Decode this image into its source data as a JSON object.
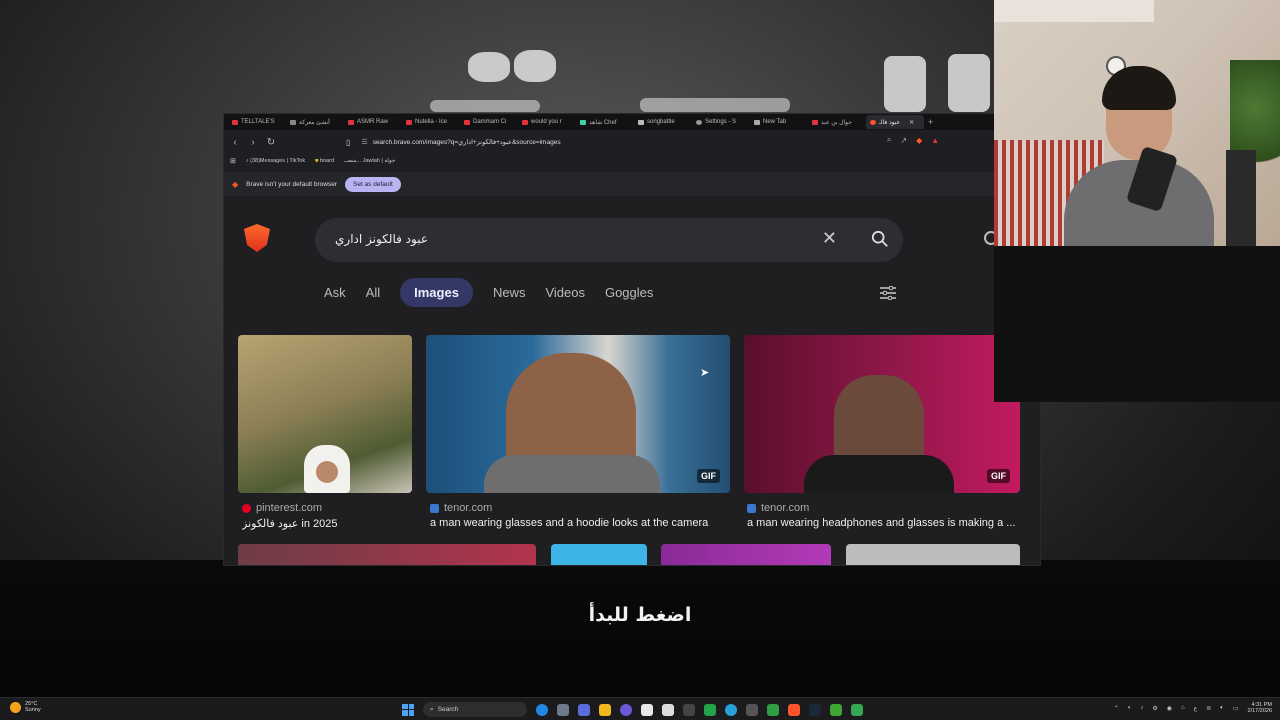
{
  "overlay": {
    "subtitle": "اضغط للبدأ"
  },
  "tabs": [
    {
      "label": "TELLTALE'S"
    },
    {
      "label": "أنشئ معركة"
    },
    {
      "label": "ASMR Raw"
    },
    {
      "label": "Nutella - Ice"
    },
    {
      "label": "Dammam Ci"
    },
    {
      "label": "would you r"
    },
    {
      "label": "شاهد Chef"
    },
    {
      "label": "songbattle"
    },
    {
      "label": "Settings - S"
    },
    {
      "label": "New Tab"
    },
    {
      "label": "جوال بن عبد"
    },
    {
      "label": "عبود فالـ"
    }
  ],
  "address": {
    "url": "search.brave.com/images?q=عبود+فالكونز+اداري&source=images"
  },
  "bookmarks": [
    {
      "label": "(38)Messages | TikTok"
    },
    {
      "label": "board"
    },
    {
      "label": "منصــ... Jawlah | جولة"
    }
  ],
  "notice": {
    "text": "Brave isn't your default browser",
    "button": "Set as default"
  },
  "search": {
    "query": "عبود فالكونز اداري"
  },
  "filters": [
    {
      "label": "Ask"
    },
    {
      "label": "All"
    },
    {
      "label": "Images"
    },
    {
      "label": "News"
    },
    {
      "label": "Videos"
    },
    {
      "label": "Goggles"
    }
  ],
  "results": [
    {
      "source": "pinterest.com",
      "caption": "عبود فالكونز in 2025",
      "badge": ""
    },
    {
      "source": "tenor.com",
      "caption": "a man wearing glasses and a hoodie looks at the camera",
      "badge": "GIF"
    },
    {
      "source": "tenor.com",
      "caption": "a man wearing headphones and glasses is making a ...",
      "badge": "GIF"
    }
  ],
  "taskbar": {
    "weather_temp": "25°C",
    "weather_desc": "Sunny",
    "search_label": "Search",
    "time": "4:31 PM",
    "date": "2/17/2026"
  },
  "colors": {
    "brave_orange": "#fb542b",
    "active_filter": "#343866",
    "notice_button": "#b9b3f2"
  }
}
